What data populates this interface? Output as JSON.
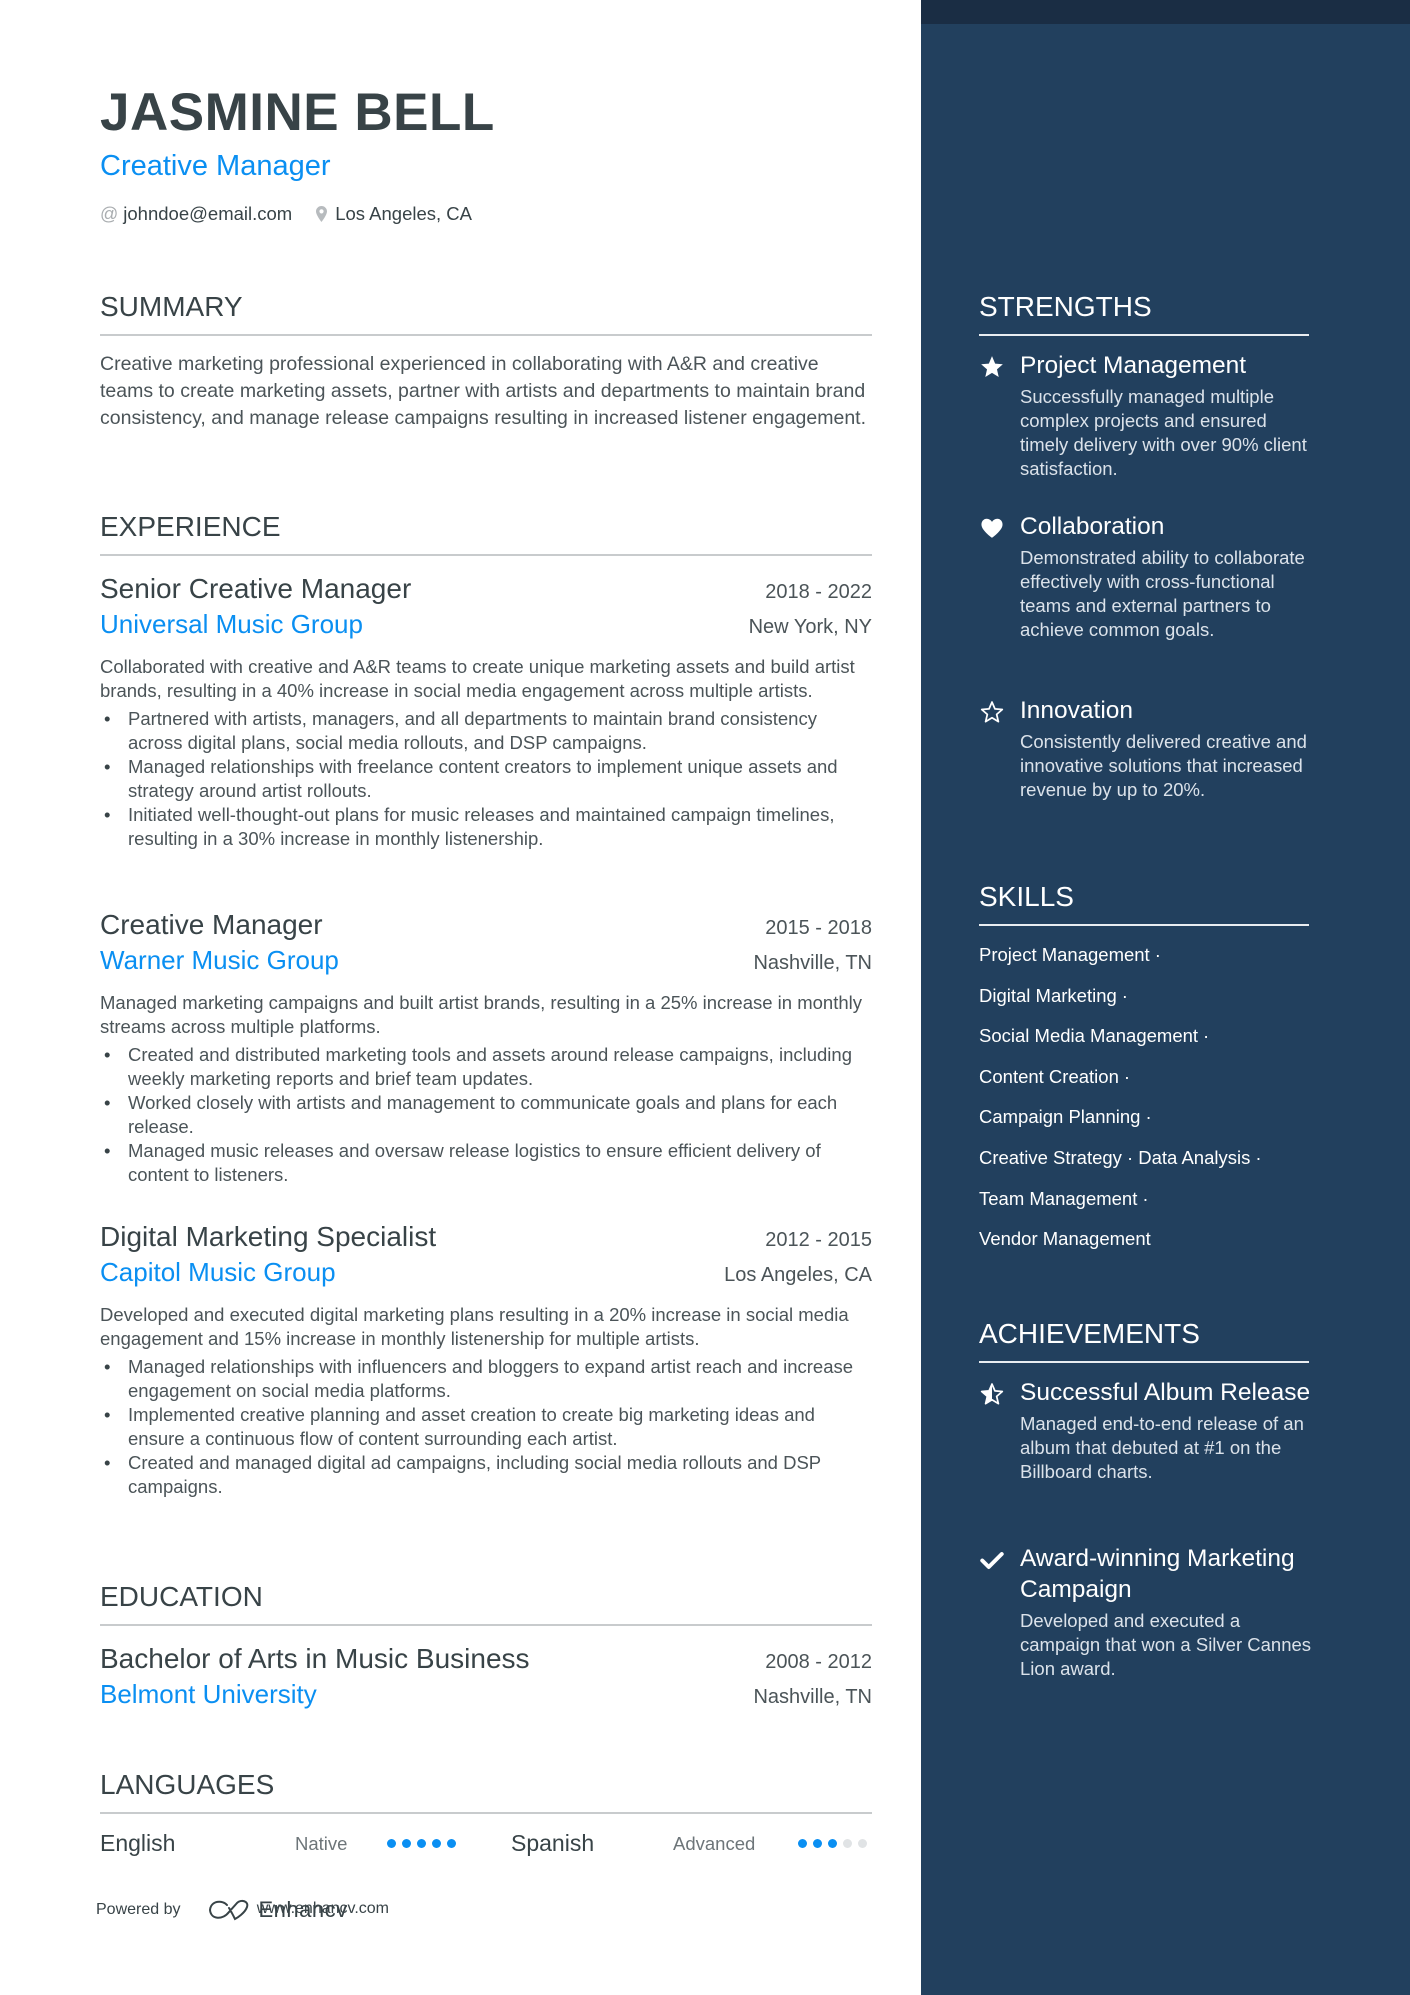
{
  "header": {
    "name": "JASMINE BELL",
    "role": "Creative Manager",
    "email_icon": "at-icon",
    "email": "johndoe@email.com",
    "location_icon": "map-pin-icon",
    "location": "Los Angeles, CA"
  },
  "summary": {
    "title": "SUMMARY",
    "text": "Creative marketing professional experienced in collaborating with A&R and creative teams to create marketing assets, partner with artists and departments to maintain brand consistency, and manage release campaigns resulting in increased listener engagement."
  },
  "experience": {
    "title": "EXPERIENCE",
    "jobs": [
      {
        "title": "Senior Creative Manager",
        "dates": "2018 - 2022",
        "company": "Universal Music Group",
        "location": "New York, NY",
        "description": "Collaborated with creative and A&R teams to create unique marketing assets and build artist brands, resulting in a 40% increase in social media engagement across multiple artists.",
        "bullets": [
          "Partnered with artists, managers, and all departments to maintain brand consistency across digital plans, social media rollouts, and DSP campaigns.",
          "Managed relationships with freelance content creators to implement unique assets and strategy around artist rollouts.",
          "Initiated well-thought-out plans for music releases and maintained campaign timelines, resulting in a 30% increase in monthly listenership."
        ]
      },
      {
        "title": "Creative Manager",
        "dates": "2015 - 2018",
        "company": "Warner Music Group",
        "location": "Nashville, TN",
        "description": "Managed marketing campaigns and built artist brands, resulting in a 25% increase in monthly streams across multiple platforms.",
        "bullets": [
          "Created and distributed marketing tools and assets around release campaigns, including weekly marketing reports and brief team updates.",
          "Worked closely with artists and management to communicate goals and plans for each release.",
          "Managed music releases and oversaw release logistics to ensure efficient delivery of content to listeners."
        ]
      },
      {
        "title": "Digital Marketing Specialist",
        "dates": "2012 - 2015",
        "company": "Capitol Music Group",
        "location": "Los Angeles, CA",
        "description": "Developed and executed digital marketing plans resulting in a 20% increase in social media engagement and 15% increase in monthly listenership for multiple artists.",
        "bullets": [
          "Managed relationships with influencers and bloggers to expand artist reach and increase engagement on social media platforms.",
          "Implemented creative planning and asset creation to create big marketing ideas and ensure a continuous flow of content surrounding each artist.",
          "Created and managed digital ad campaigns, including social media rollouts and DSP campaigns."
        ]
      }
    ]
  },
  "education": {
    "title": "EDUCATION",
    "degree": "Bachelor of Arts in Music Business",
    "dates": "2008 - 2012",
    "school": "Belmont University",
    "location": "Nashville, TN"
  },
  "languages": {
    "title": "LANGUAGES",
    "items": [
      {
        "name": "English",
        "level": "Native",
        "rating": 5,
        "max": 5
      },
      {
        "name": "Spanish",
        "level": "Advanced",
        "rating": 3,
        "max": 5
      }
    ]
  },
  "footer": {
    "powered_by": "Powered by",
    "brand": "Enhancv",
    "brand_icon": "enhancv-logo-icon",
    "url": "www.enhancv.com"
  },
  "strengths": {
    "title": "STRENGTHS",
    "items": [
      {
        "icon": "star-filled-icon",
        "title": "Project Management",
        "description": "Successfully managed multiple complex projects and ensured timely delivery with over 90% client satisfaction."
      },
      {
        "icon": "heart-icon",
        "title": "Collaboration",
        "description": "Demonstrated ability to collaborate effectively with cross-functional teams and external partners to achieve common goals."
      },
      {
        "icon": "star-outline-icon",
        "title": "Innovation",
        "description": "Consistently delivered creative and innovative solutions that increased revenue by up to 20%."
      }
    ]
  },
  "skills": {
    "title": "SKILLS",
    "lines": [
      [
        "Project Management"
      ],
      [
        "Digital Marketing"
      ],
      [
        "Social Media Management"
      ],
      [
        "Content Creation"
      ],
      [
        "Campaign Planning"
      ],
      [
        "Creative Strategy",
        "Data Analysis"
      ],
      [
        "Team Management"
      ],
      [
        "Vendor Management"
      ]
    ],
    "separator": "·"
  },
  "achievements": {
    "title": "ACHIEVEMENTS",
    "items": [
      {
        "icon": "star-half-icon",
        "title": "Successful Album Release",
        "description": "Managed end-to-end release of an album that debuted at #1 on the Billboard charts."
      },
      {
        "icon": "checkmark-icon",
        "title": "Award-winning Marketing Campaign",
        "description": "Developed and executed a campaign that won a Silver Cannes Lion award."
      }
    ]
  },
  "colors": {
    "accent": "#0a8ff2",
    "text": "#384347",
    "sidebar_bg": "#22405e",
    "sidebar_top": "#1a2d44",
    "dot_off": "#e0e3e5"
  }
}
